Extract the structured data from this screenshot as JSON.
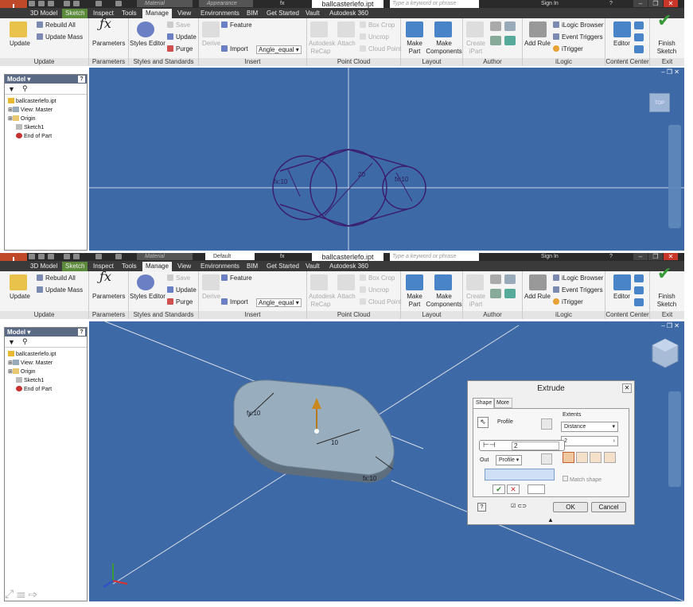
{
  "app": {
    "logo": "I",
    "logo_sub": "PRO",
    "filename": "ballcasterlefo.ipt",
    "search_placeholder": "Type a keyword or phrase",
    "sign_in": "Sign In",
    "help": "?"
  },
  "top_qat": {
    "material": "Material",
    "appearance": "Appearance",
    "fx": "fx"
  },
  "bot_qat": {
    "material": "Material",
    "appearance": "Default",
    "fx": "fx"
  },
  "tabs": [
    "3D Model",
    "Sketch",
    "Inspect",
    "Tools",
    "Manage",
    "View",
    "Environments",
    "BIM",
    "Get Started",
    "Vault",
    "Autodesk 360"
  ],
  "ribbon": {
    "update": "Update",
    "rebuild_all": "Rebuild All",
    "update_mass": "Update Mass",
    "parameters": "Parameters",
    "styles_editor": "Styles Editor",
    "save": "Save",
    "update2": "Update",
    "purge": "Purge",
    "derive": "Derive",
    "feature": "Feature",
    "import": "Import",
    "angle_equal": "Angle_equal",
    "autodesk_recap": "Autodesk ReCap",
    "attach": "Attach",
    "box_crop": "Box Crop",
    "uncrop": "Uncrop",
    "cloud_point": "Cloud Point",
    "make_part": "Make Part",
    "make_components": "Make Components",
    "create_ipart": "Create iPart",
    "add_rule": "Add Rule",
    "ilogic_browser": "iLogic Browser",
    "event_triggers": "Event Triggers",
    "itrigger": "iTrigger",
    "editor": "Editor",
    "finish_sketch": "Finish Sketch"
  },
  "groups": {
    "update": "Update",
    "parameters": "Parameters",
    "styles": "Styles and Standards",
    "insert": "Insert",
    "point_cloud": "Point Cloud",
    "layout": "Layout",
    "author": "Author",
    "ilogic": "iLogic",
    "content_center": "Content Center",
    "exit": "Exit"
  },
  "browser": {
    "header": "Model",
    "items": [
      "ballcasterlefo.ipt",
      "View: Master",
      "Origin",
      "Sketch1",
      "End of Part"
    ]
  },
  "sketch_dims": {
    "d1": "fx:10",
    "d2": "20",
    "d3": "fx:10"
  },
  "model_dims": {
    "d1": "fx:10",
    "d2": "10",
    "d3": "fx:10"
  },
  "viewcube_label": "TOP",
  "extrude": {
    "title": "Extrude",
    "tab_shape": "Shape",
    "tab_more": "More",
    "profile": "Profile",
    "output": "Out",
    "profile_btn": "Profile",
    "distance_value": "2",
    "extents": "Extents",
    "extents_value": "Distance",
    "extents_distance": "2",
    "match_shape": "Match shape",
    "ok": "OK",
    "cancel": "Cancel"
  },
  "colors": {
    "viewport": "#3d6aa6",
    "sketch_line": "#3b1f6e",
    "accent_orange": "#c0492a"
  }
}
